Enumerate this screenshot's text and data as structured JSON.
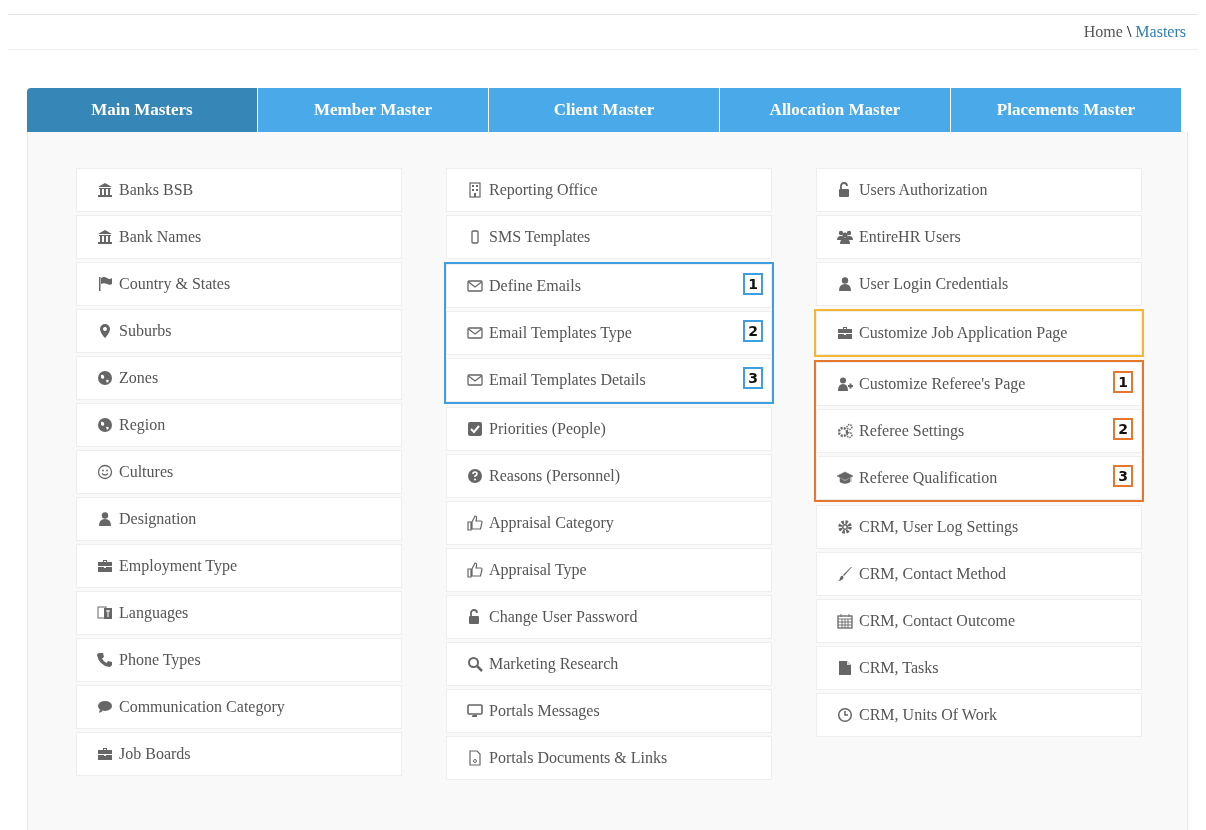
{
  "breadcrumb": {
    "home": "Home",
    "separator": "\\",
    "current": "Masters"
  },
  "tabs": [
    {
      "label": "Main Masters",
      "selected": true
    },
    {
      "label": "Member Master",
      "selected": false
    },
    {
      "label": "Client Master",
      "selected": false
    },
    {
      "label": "Allocation Master",
      "selected": false
    },
    {
      "label": "Placements Master",
      "selected": false
    }
  ],
  "columns": [
    {
      "sections": [
        {
          "items": [
            {
              "label": "Banks BSB",
              "kind": "bank"
            },
            {
              "label": "Bank Names",
              "kind": "bank"
            },
            {
              "label": "Country & States",
              "kind": "flag"
            },
            {
              "label": "Suburbs",
              "kind": "pin"
            },
            {
              "label": "Zones",
              "kind": "globe"
            },
            {
              "label": "Region",
              "kind": "globe"
            },
            {
              "label": "Cultures",
              "kind": "smile"
            },
            {
              "label": "Designation",
              "kind": "user"
            },
            {
              "label": "Employment Type",
              "kind": "briefcase"
            },
            {
              "label": "Languages",
              "kind": "language"
            },
            {
              "label": "Phone Types",
              "kind": "phone"
            },
            {
              "label": "Communication Category",
              "kind": "comment"
            },
            {
              "label": "Job Boards",
              "kind": "briefcase"
            }
          ]
        }
      ]
    },
    {
      "sections": [
        {
          "items": [
            {
              "label": "Reporting Office",
              "kind": "building"
            },
            {
              "label": "SMS Templates",
              "kind": "mobile"
            }
          ]
        },
        {
          "color": "#3d9ee0",
          "items": [
            {
              "label": "Define Emails",
              "kind": "envelope",
              "badge": "1"
            },
            {
              "label": "Email Templates Type",
              "kind": "envelope",
              "badge": "2"
            },
            {
              "label": "Email Templates Details",
              "kind": "envelope",
              "badge": "3"
            }
          ]
        },
        {
          "items": [
            {
              "label": "Priorities (People)",
              "kind": "check"
            },
            {
              "label": "Reasons (Personnel)",
              "kind": "question"
            },
            {
              "label": "Appraisal Category",
              "kind": "thumb"
            },
            {
              "label": "Appraisal Type",
              "kind": "thumb"
            },
            {
              "label": "Change User Password",
              "kind": "unlock"
            },
            {
              "label": "Marketing Research",
              "kind": "search"
            },
            {
              "label": "Portals Messages",
              "kind": "monitor"
            },
            {
              "label": "Portals Documents & Links",
              "kind": "document"
            }
          ]
        }
      ]
    },
    {
      "sections": [
        {
          "items": [
            {
              "label": "Users Authorization",
              "kind": "unlock"
            },
            {
              "label": "EntireHR Users",
              "kind": "users"
            },
            {
              "label": "User Login Credentials",
              "kind": "user"
            }
          ]
        },
        {
          "color": "#f5b731",
          "items": [
            {
              "label": "Customize Job Application Page",
              "kind": "briefcase"
            }
          ]
        },
        {
          "color": "#e5772e",
          "items": [
            {
              "label": "Customize Referee's Page",
              "kind": "userplus",
              "badge": "1"
            },
            {
              "label": "Referee Settings",
              "kind": "cogs",
              "badge": "2"
            },
            {
              "label": "Referee Qualification",
              "kind": "cap",
              "badge": "3"
            }
          ]
        },
        {
          "items": [
            {
              "label": "CRM, User Log Settings",
              "kind": "gear"
            },
            {
              "label": "CRM, Contact Method",
              "kind": "brush"
            },
            {
              "label": "CRM, Contact Outcome",
              "kind": "calendar"
            },
            {
              "label": "CRM, Tasks",
              "kind": "file"
            },
            {
              "label": "CRM, Units Of Work",
              "kind": "clock"
            }
          ]
        }
      ]
    }
  ]
}
